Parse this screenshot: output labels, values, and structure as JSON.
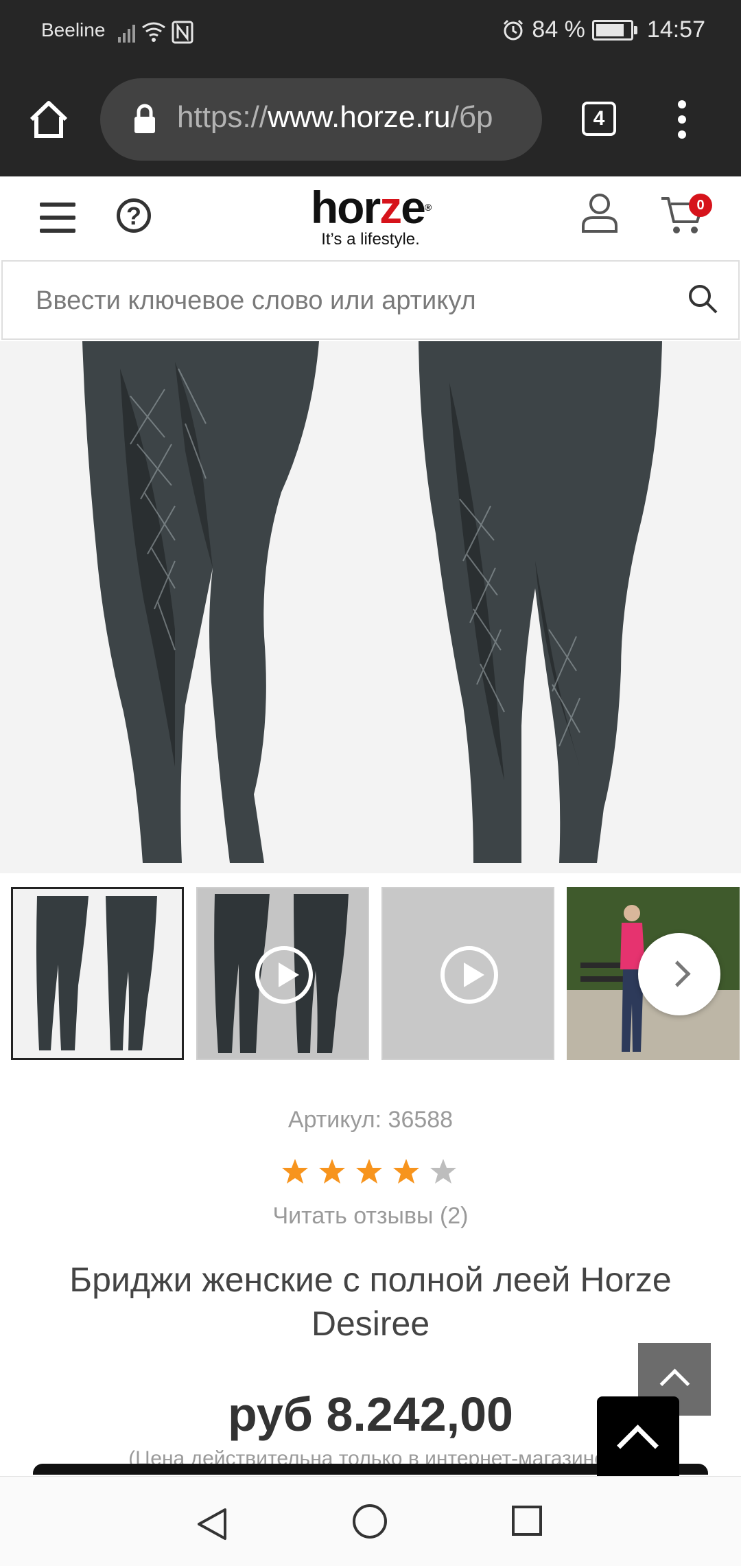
{
  "status_bar": {
    "carrier": "Beeline",
    "alarm_icon": "alarm-icon",
    "battery": "84 %",
    "time": "14:57"
  },
  "browser": {
    "url_scheme": "https://",
    "url_host": "www.horze.ru",
    "url_path": "/бр",
    "tab_count": "4"
  },
  "site": {
    "logo_text_1": "hor",
    "logo_text_z": "z",
    "logo_text_2": "e",
    "logo_tagline": "It’s a lifestyle.",
    "cart_count": "0",
    "brand_color": "#d6131b"
  },
  "search": {
    "placeholder": "Ввести ключевое слово или артикул"
  },
  "product": {
    "sku": "Артикул: 36588",
    "rating": 4,
    "rating_max": 5,
    "reviews_link": "Читать отзывы (2)",
    "title": "Бриджи женские с полной леей Horze Desiree",
    "price": "руб 8.242,00",
    "price_note": "(Цена действительна только в интернет-магазине)"
  },
  "thumbnails": [
    {
      "type": "image",
      "selected": true
    },
    {
      "type": "video",
      "selected": false
    },
    {
      "type": "video",
      "selected": false
    },
    {
      "type": "image",
      "selected": false
    }
  ]
}
